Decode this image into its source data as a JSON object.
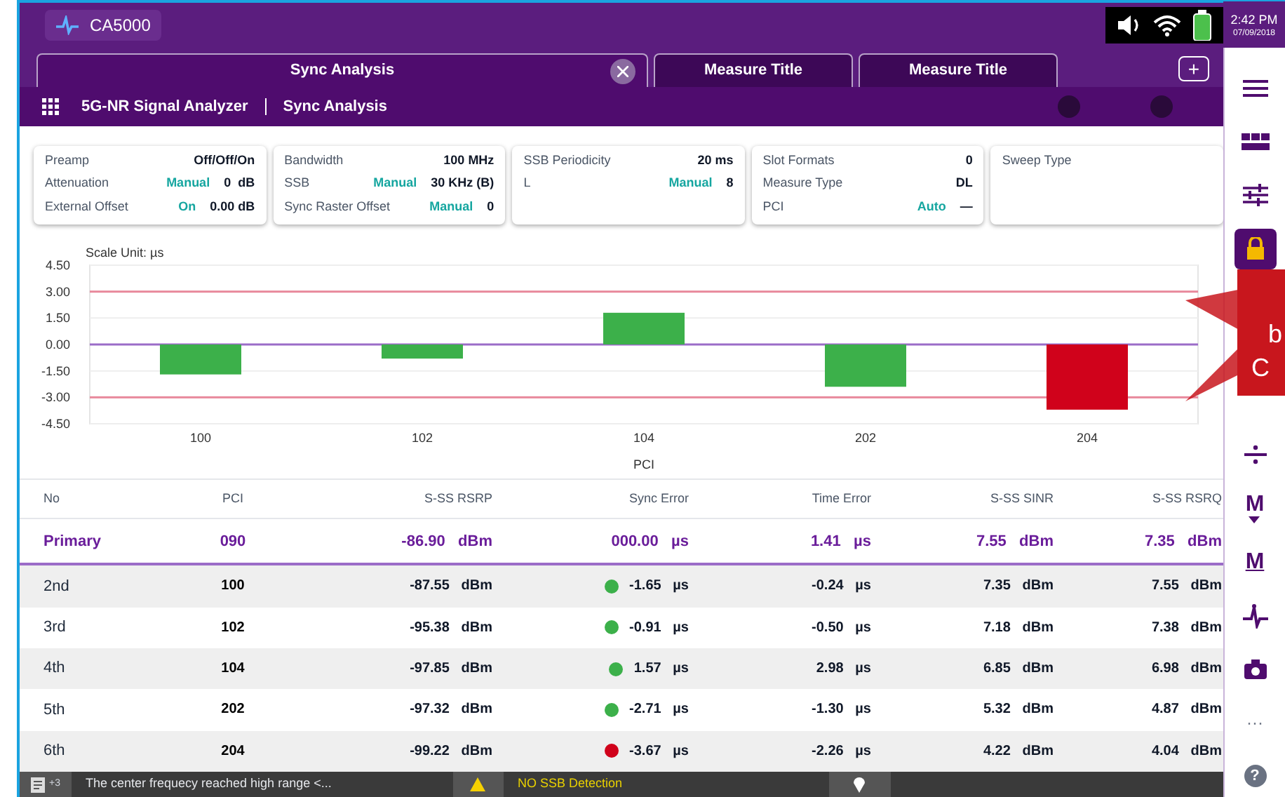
{
  "app": {
    "title": "CA5000"
  },
  "status": {
    "time": "2:42 PM",
    "date": "07/09/2018"
  },
  "tabs": [
    {
      "label": "Sync Analysis",
      "selected": true,
      "closable": true
    },
    {
      "label": "Measure Title",
      "selected": false,
      "closable": false
    },
    {
      "label": "Measure Title",
      "selected": false,
      "closable": false
    }
  ],
  "add_tab": "+",
  "breadcrumb": [
    "5G-NR Signal Analyzer",
    "Sync Analysis"
  ],
  "settings_cards": [
    {
      "rows": [
        {
          "label": "Preamp",
          "value": "Off/Off/On"
        },
        {
          "label": "Attenuation",
          "mode": "Manual",
          "value": "0  dB"
        },
        {
          "label": "External Offset",
          "mode": "On",
          "value": "0.00 dB"
        }
      ]
    },
    {
      "rows": [
        {
          "label": "Bandwidth",
          "value": "100 MHz"
        },
        {
          "label": "SSB",
          "mode": "Manual",
          "value": "30 KHz (B)"
        },
        {
          "label": "Sync Raster Offset",
          "mode": "Manual",
          "value": "0"
        }
      ]
    },
    {
      "rows": [
        {
          "label": "SSB Periodicity",
          "value": "20 ms"
        },
        {
          "label": "L",
          "mode": "Manual",
          "value": "8"
        }
      ]
    },
    {
      "rows": [
        {
          "label": "Slot Formats",
          "value": "0"
        },
        {
          "label": "Measure Type",
          "value": "DL"
        },
        {
          "label": "PCI",
          "mode": "Auto",
          "value": "—"
        }
      ]
    },
    {
      "rows": [
        {
          "label": "Sweep Type"
        }
      ]
    }
  ],
  "chart_data": {
    "type": "bar",
    "title": "Scale Unit: µs",
    "xlabel": "PCI",
    "categories": [
      "100",
      "102",
      "104",
      "202",
      "204"
    ],
    "series": [
      {
        "color": "#3cb04a",
        "values": [
          -1.7,
          -0.8,
          1.8,
          -2.4,
          null
        ]
      },
      {
        "color": "#d0021b",
        "values": [
          null,
          null,
          null,
          null,
          -3.7
        ]
      }
    ],
    "grid": true,
    "ylim": [
      -4.5,
      4.5
    ],
    "yticks": [
      {
        "value": 4.5,
        "label": "4.50"
      },
      {
        "value": 3,
        "label": "3.00"
      },
      {
        "value": 1.5,
        "label": "1.50"
      },
      {
        "value": 0,
        "label": "0.00"
      },
      {
        "value": -1.5,
        "label": "-1.50"
      },
      {
        "value": -3,
        "label": "-3.00"
      },
      {
        "value": -4.5,
        "label": "-4.50"
      }
    ],
    "ref_lines": [
      {
        "axis": "y",
        "value": 3,
        "color": "#e8899c"
      },
      {
        "axis": "y",
        "value": -3,
        "color": "#e8899c"
      },
      {
        "axis": "y",
        "value": 0,
        "color": "#9b6cc8"
      }
    ]
  },
  "table": {
    "columns": [
      "No",
      "PCI",
      "S-SS RSRP",
      "Sync Error",
      "Time Error",
      "S-SS SINR",
      "S-SS RSRQ"
    ],
    "primary": {
      "no": "Primary",
      "pci": "090",
      "rsrp": {
        "value": "-86.90",
        "unit": "dBm"
      },
      "sync_error": {
        "value": "000.00",
        "unit": "µs"
      },
      "time_error": {
        "value": "1.41",
        "unit": "µs"
      },
      "sinr": {
        "value": "7.55",
        "unit": "dBm"
      },
      "rsrq": {
        "value": "7.35",
        "unit": "dBm"
      }
    },
    "rows": [
      {
        "no": "2nd",
        "pci": "100",
        "rsrp": {
          "value": "-87.55",
          "unit": "dBm"
        },
        "color": "#3cb04a",
        "sync_error": {
          "value": "-1.65",
          "unit": "µs"
        },
        "time_error": {
          "value": "-0.24",
          "unit": "µs"
        },
        "sinr": {
          "value": "7.35",
          "unit": "dBm"
        },
        "rsrq": {
          "value": "7.55",
          "unit": "dBm"
        }
      },
      {
        "no": "3rd",
        "pci": "102",
        "rsrp": {
          "value": "-95.38",
          "unit": "dBm"
        },
        "color": "#3cb04a",
        "sync_error": {
          "value": "-0.91",
          "unit": "µs"
        },
        "time_error": {
          "value": "-0.50",
          "unit": "µs"
        },
        "sinr": {
          "value": "7.18",
          "unit": "dBm"
        },
        "rsrq": {
          "value": "7.38",
          "unit": "dBm"
        }
      },
      {
        "no": "4th",
        "pci": "104",
        "rsrp": {
          "value": "-97.85",
          "unit": "dBm"
        },
        "color": "#3cb04a",
        "sync_error": {
          "value": "1.57",
          "unit": "µs"
        },
        "time_error": {
          "value": "2.98",
          "unit": "µs"
        },
        "sinr": {
          "value": "6.85",
          "unit": "dBm"
        },
        "rsrq": {
          "value": "6.98",
          "unit": "dBm"
        }
      },
      {
        "no": "5th",
        "pci": "202",
        "rsrp": {
          "value": "-97.32",
          "unit": "dBm"
        },
        "color": "#3cb04a",
        "sync_error": {
          "value": "-2.71",
          "unit": "µs"
        },
        "time_error": {
          "value": "-1.30",
          "unit": "µs"
        },
        "sinr": {
          "value": "5.32",
          "unit": "dBm"
        },
        "rsrq": {
          "value": "4.87",
          "unit": "dBm"
        }
      },
      {
        "no": "6th",
        "pci": "204",
        "rsrp": {
          "value": "-99.22",
          "unit": "dBm"
        },
        "color": "#d0021b",
        "sync_error": {
          "value": "-3.67",
          "unit": "µs"
        },
        "time_error": {
          "value": "-2.26",
          "unit": "µs"
        },
        "sinr": {
          "value": "4.22",
          "unit": "dBm"
        },
        "rsrq": {
          "value": "4.04",
          "unit": "dBm"
        }
      }
    ]
  },
  "status_bar": {
    "count": "+3",
    "message": "The center frequecy reached high range <...",
    "warning": "NO SSB Detection"
  },
  "sidebar": [
    {
      "kind": "menu",
      "selected": false
    },
    {
      "kind": "layout",
      "selected": false
    },
    {
      "kind": "sliders",
      "selected": false
    },
    {
      "kind": "lock",
      "selected": true
    },
    {
      "kind": "split",
      "selected": false
    },
    {
      "kind": "marker_down",
      "glyph": "M",
      "selected": false
    },
    {
      "kind": "marker_bar",
      "glyph": "M",
      "selected": false
    },
    {
      "kind": "pulse",
      "selected": false
    },
    {
      "kind": "camera",
      "selected": false
    },
    {
      "kind": "more",
      "glyph": "···",
      "selected": false
    },
    {
      "kind": "help",
      "glyph": "?",
      "selected": false
    }
  ],
  "callout": {
    "lines": [
      "b",
      "C"
    ]
  }
}
